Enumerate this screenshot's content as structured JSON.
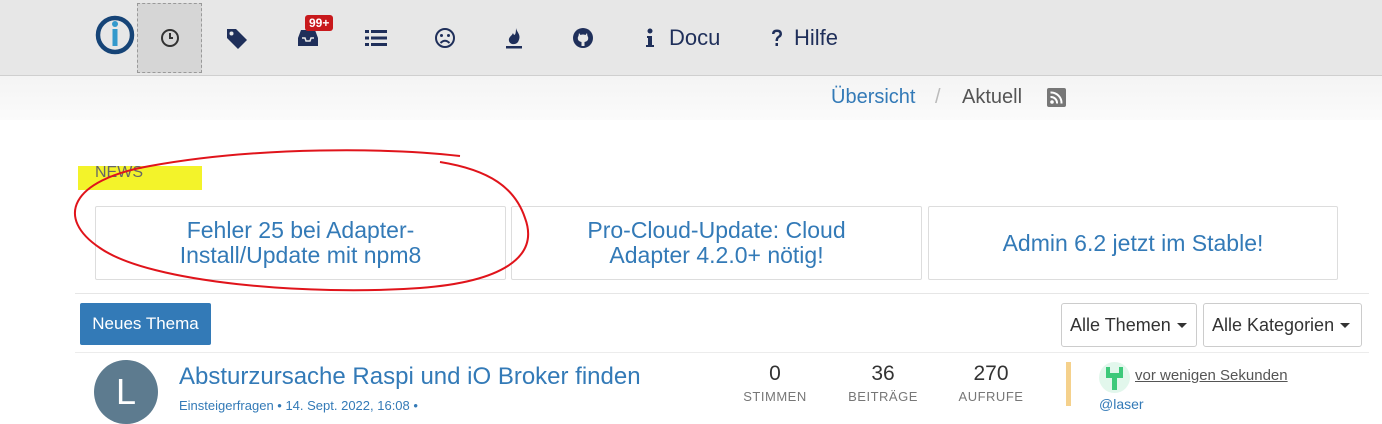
{
  "nav": {
    "items": [
      {
        "name": "recent",
        "icon": "clock-icon",
        "active": true
      },
      {
        "name": "tags",
        "icon": "tags-icon"
      },
      {
        "name": "unread",
        "icon": "inbox-icon",
        "badge": "99+"
      },
      {
        "name": "categories",
        "icon": "list-icon"
      },
      {
        "name": "unsolved",
        "icon": "frown-icon"
      },
      {
        "name": "popular",
        "icon": "fire-icon"
      },
      {
        "name": "github",
        "icon": "github-icon"
      }
    ],
    "docu_label": "Docu",
    "hilfe_label": "Hilfe",
    "unread_badge": "99+"
  },
  "breadcrumb": {
    "link": "Übersicht",
    "separator": "/",
    "current": "Aktuell"
  },
  "news": {
    "label": "NEWS",
    "cards": [
      {
        "title": "Fehler 25 bei Adapter-Install/Update mit npm8"
      },
      {
        "title": "Pro-Cloud-Update: Cloud Adapter 4.2.0+ nötig!"
      },
      {
        "title": "Admin 6.2 jetzt im Stable!"
      }
    ]
  },
  "toolbar": {
    "new_topic": "Neues Thema",
    "filter_topics": "Alle Themen",
    "filter_categories": "Alle Kategorien"
  },
  "topic": {
    "avatar_letter": "L",
    "title": "Absturzursache Raspi und iO Broker finden",
    "meta": "Einsteigerfragen • 14. Sept. 2022, 16:08 •",
    "votes": "0",
    "votes_label": "STIMMEN",
    "posts": "36",
    "posts_label": "BEITRÄGE",
    "views": "270",
    "views_label": "AUFRUFE",
    "last_time": "vor wenigen Sekunden",
    "last_user": "@laser"
  },
  "colors": {
    "accent": "#337ab7",
    "highlight": "#f3f32a",
    "annotation": "#e0141b"
  }
}
